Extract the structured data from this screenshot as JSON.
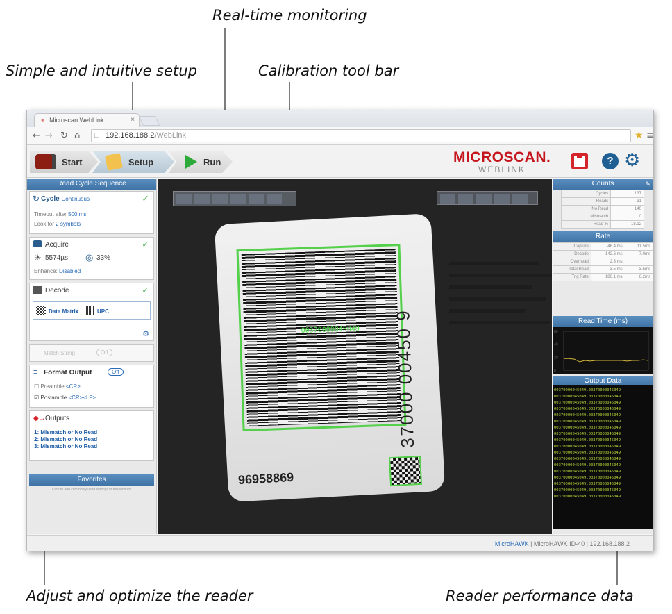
{
  "callouts": {
    "realtime": "Real-time monitoring",
    "setup": "Simple and intuitive setup",
    "calibration": "Calibration tool bar",
    "adjust": "Adjust and optimize the reader",
    "performance": "Reader performance data"
  },
  "browser": {
    "tab_title": "Microscan WebLink",
    "url_host": "192.168.188.2",
    "url_path": "/WebLink"
  },
  "toolbar": {
    "start": "Start",
    "setup": "Setup",
    "run": "Run",
    "brand": "MICROSCAN.",
    "brand_sub": "WEBLINK"
  },
  "left_panel": {
    "header": "Read Cycle Sequence",
    "cycle": {
      "title": "Cycle",
      "mode": "Continuous",
      "timeout_prefix": "Timeout after",
      "timeout_value": "500 ms",
      "look_prefix": "Look for",
      "look_value": "2 symbols"
    },
    "acquire": {
      "title": "Acquire",
      "exposure": "5574µs",
      "gain": "33%",
      "enhance_label": "Enhance:",
      "enhance_value": "Disabled"
    },
    "decode": {
      "title": "Decode",
      "symbol_1": "Data Matrix",
      "symbol_2": "UPC"
    },
    "match": {
      "title": "Match String",
      "state": "Off"
    },
    "format_output": {
      "title": "Format Output",
      "state": "Off",
      "preamble_label": "Preamble",
      "preamble_value": "<CR>",
      "postamble_label": "Postamble",
      "postamble_value": "<CR><LF>"
    },
    "outputs": {
      "title": "Outputs",
      "items": [
        "1: Mismatch or No Read",
        "2: Mismatch or No Read",
        "3: Mismatch or No Read"
      ]
    },
    "favorites": {
      "header": "Favorites",
      "hint": "Click to add commonly used settings to this location"
    }
  },
  "viewer": {
    "decoded_text": "00370000045049",
    "upc_digits": "0 37000 00450 9",
    "label_number": "96958869"
  },
  "right_panel": {
    "counts_header": "Counts",
    "counts": [
      {
        "label": "Cycles",
        "value": "137"
      },
      {
        "label": "Reads",
        "value": "31"
      },
      {
        "label": "No Read",
        "value": "140"
      },
      {
        "label": "Mismatch",
        "value": "0"
      },
      {
        "label": "Read %",
        "value": "18.12"
      }
    ],
    "rate_header": "Rate",
    "rates": [
      {
        "label": "Capture",
        "v1": "46.4 ms",
        "v2": "11.5ms"
      },
      {
        "label": "Decode",
        "v1": "142.6 ms",
        "v2": "7.0ms"
      },
      {
        "label": "Overhead",
        "v1": "2.3 ms",
        "v2": ""
      },
      {
        "label": "Total Read",
        "v1": "3.5 ms",
        "v2": "3.5ms"
      },
      {
        "label": "Trig Rate",
        "v1": "180.1 ms",
        "v2": "6.2ms"
      }
    ],
    "readtime_header": "Read Time (ms)",
    "readtime_values": [
      18,
      18,
      17,
      13,
      15,
      14,
      15,
      15,
      15,
      15,
      15,
      15,
      14,
      15,
      15,
      16,
      15
    ],
    "readtime_ticks": [
      "60",
      "40",
      "20",
      "0"
    ],
    "output_header": "Output Data",
    "output_lines": [
      "00370000045049,00370000045049",
      "00370000045049,00370000045049",
      "00370000045049,00370000045049",
      "00370000045049,00370000045049",
      "00370000045049,00370000045049",
      "00370000045049,00370000045049",
      "00370000045049,00370000045049",
      "00370000045049,00370000045049",
      "00370000045049,00370000045049",
      "00370000045049,00370000045049",
      "00370000045049,00370000045049",
      "00370000045049,00370000045049",
      "00370000045049,00370000045049",
      "00370000045049,00370000045049",
      "00370000045049,00370000045049",
      "00370000045049,00370000045049",
      "00370000045049,00370000045049",
      "00370000045049,00370000045049"
    ]
  },
  "status": {
    "device_link": "MicroHAWK",
    "device_info": "MicroHAWK ID-40 | 192.168.188.2"
  },
  "colors": {
    "brand_red": "#c4161c",
    "accent_blue": "#1f5f94",
    "decode_green": "#54d04a"
  }
}
